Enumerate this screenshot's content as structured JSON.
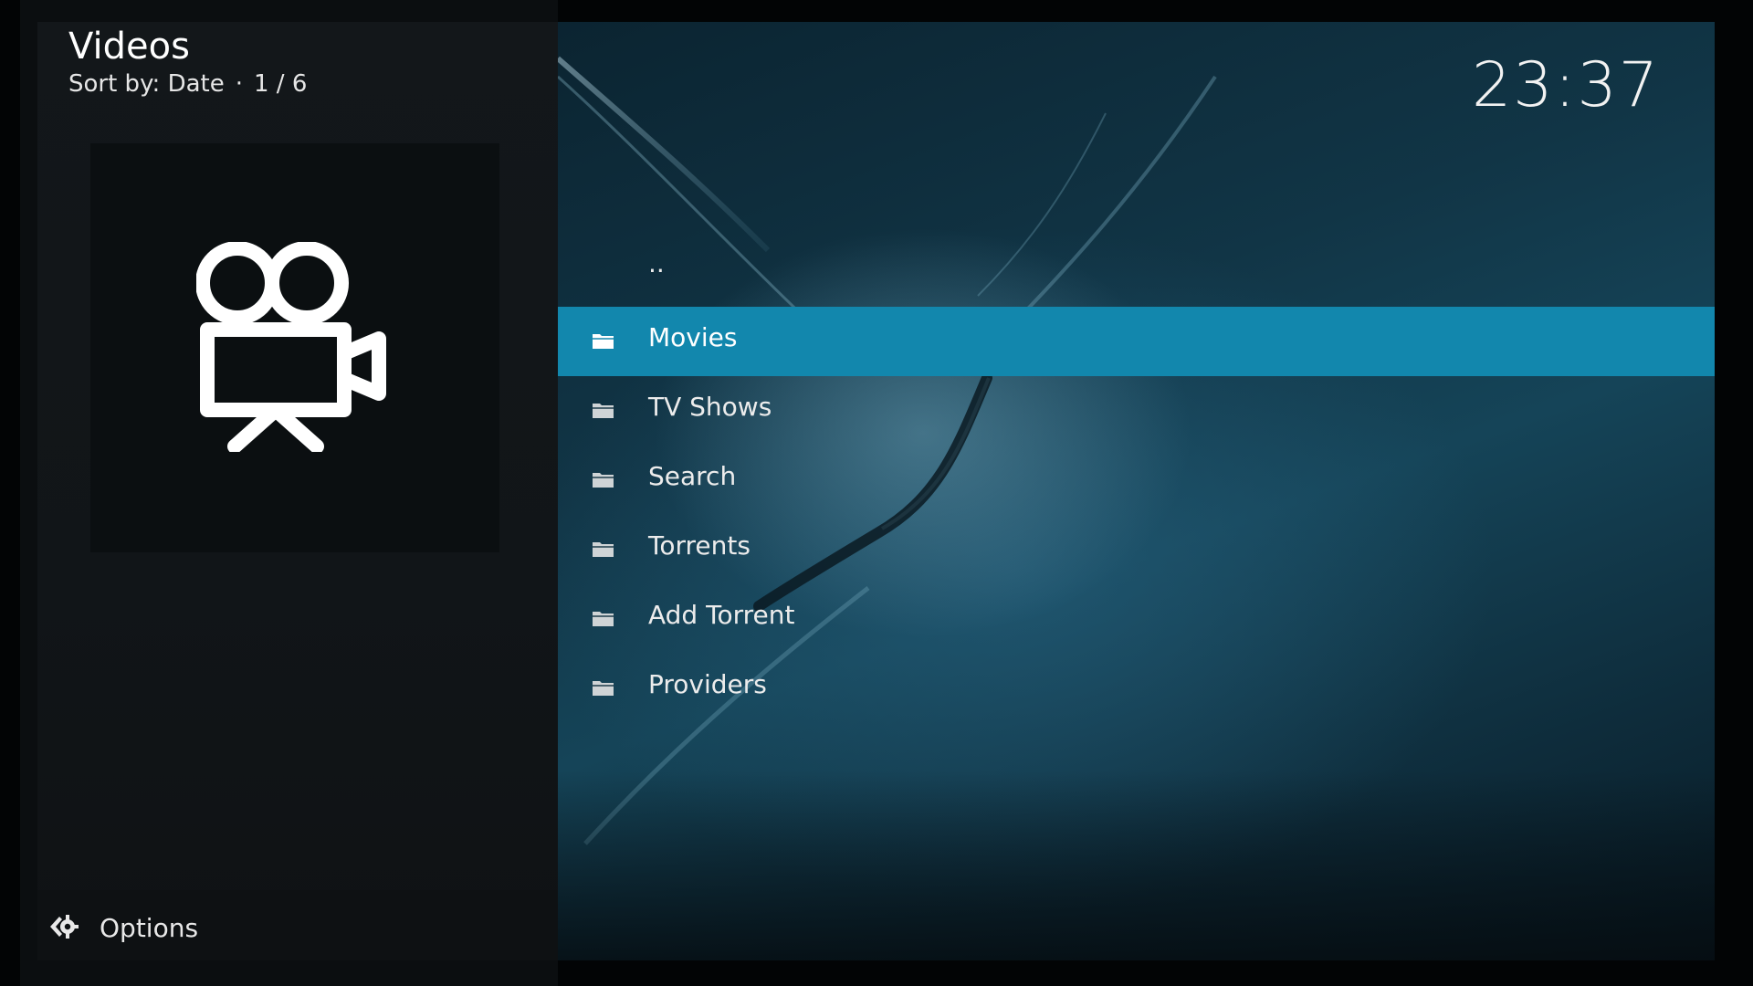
{
  "header": {
    "title": "Videos",
    "sort_label": "Sort by: Date",
    "separator": "·",
    "position": "1 / 6"
  },
  "clock": "23:37",
  "thumbnail": {
    "icon": "movie-camera-icon"
  },
  "menu": {
    "selected_index": 1,
    "items": [
      {
        "label": "..",
        "icon": ""
      },
      {
        "label": "Movies",
        "icon": "folder-icon"
      },
      {
        "label": "TV Shows",
        "icon": "folder-icon"
      },
      {
        "label": "Search",
        "icon": "folder-icon"
      },
      {
        "label": "Torrents",
        "icon": "folder-icon"
      },
      {
        "label": "Add Torrent",
        "icon": "folder-icon"
      },
      {
        "label": "Providers",
        "icon": "folder-icon"
      }
    ]
  },
  "footer": {
    "options_label": "Options",
    "options_icon": "options-icon"
  },
  "colors": {
    "accent": "#1287ad",
    "text": "#ececec",
    "panel": "#13171a"
  }
}
